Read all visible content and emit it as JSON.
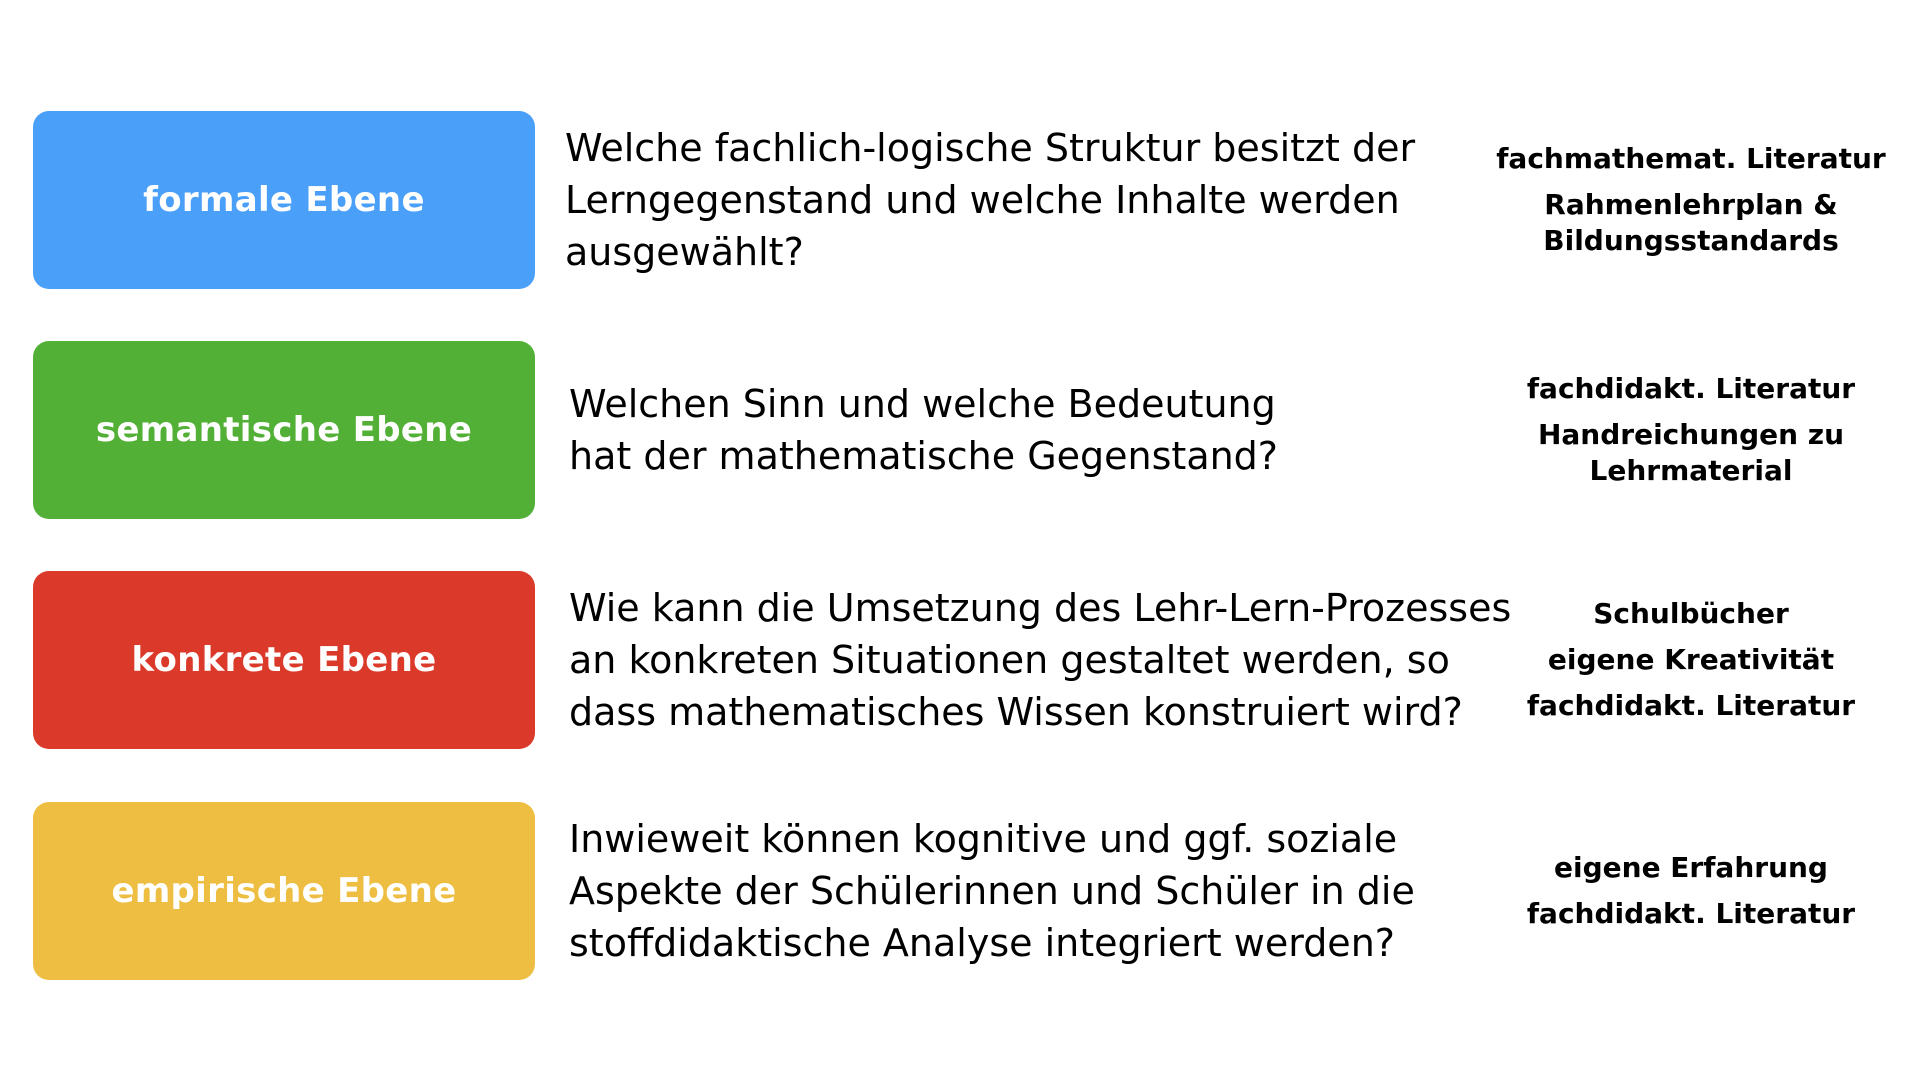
{
  "rows": [
    {
      "level": "formale Ebene",
      "color": "#4A9FF8",
      "question_lines": [
        "Welche fachlich-logische Struktur besitzt der",
        "Lerngegenstand und welche Inhalte werden",
        "ausgewählt?"
      ],
      "sources": [
        "fachmathemat. Literatur",
        "Rahmenlehrplan &\nBildungsstandards"
      ]
    },
    {
      "level": "semantische Ebene",
      "color": "#53B037",
      "question_lines": [
        "Welchen Sinn und welche Bedeutung",
        "hat der mathematische Gegenstand?"
      ],
      "sources": [
        "fachdidakt. Literatur",
        "Handreichungen zu\nLehrmaterial"
      ]
    },
    {
      "level": "konkrete Ebene",
      "color": "#DB3A2A",
      "question_lines": [
        "Wie kann die Umsetzung des Lehr-Lern-Prozesses",
        "an konkreten Situationen gestaltet werden, so",
        "dass mathematisches Wissen konstruiert wird?"
      ],
      "sources": [
        "Schulbücher",
        "eigene Kreativität",
        "fachdidakt. Literatur"
      ]
    },
    {
      "level": "empirische Ebene",
      "color": "#EDBE41",
      "question_lines": [
        "Inwieweit können kognitive und ggf. soziale",
        "Aspekte der Schülerinnen und Schüler in die",
        "stoffdidaktische Analyse integriert werden?"
      ],
      "sources": [
        "eigene Erfahrung",
        "fachdidakt. Literatur"
      ]
    }
  ]
}
